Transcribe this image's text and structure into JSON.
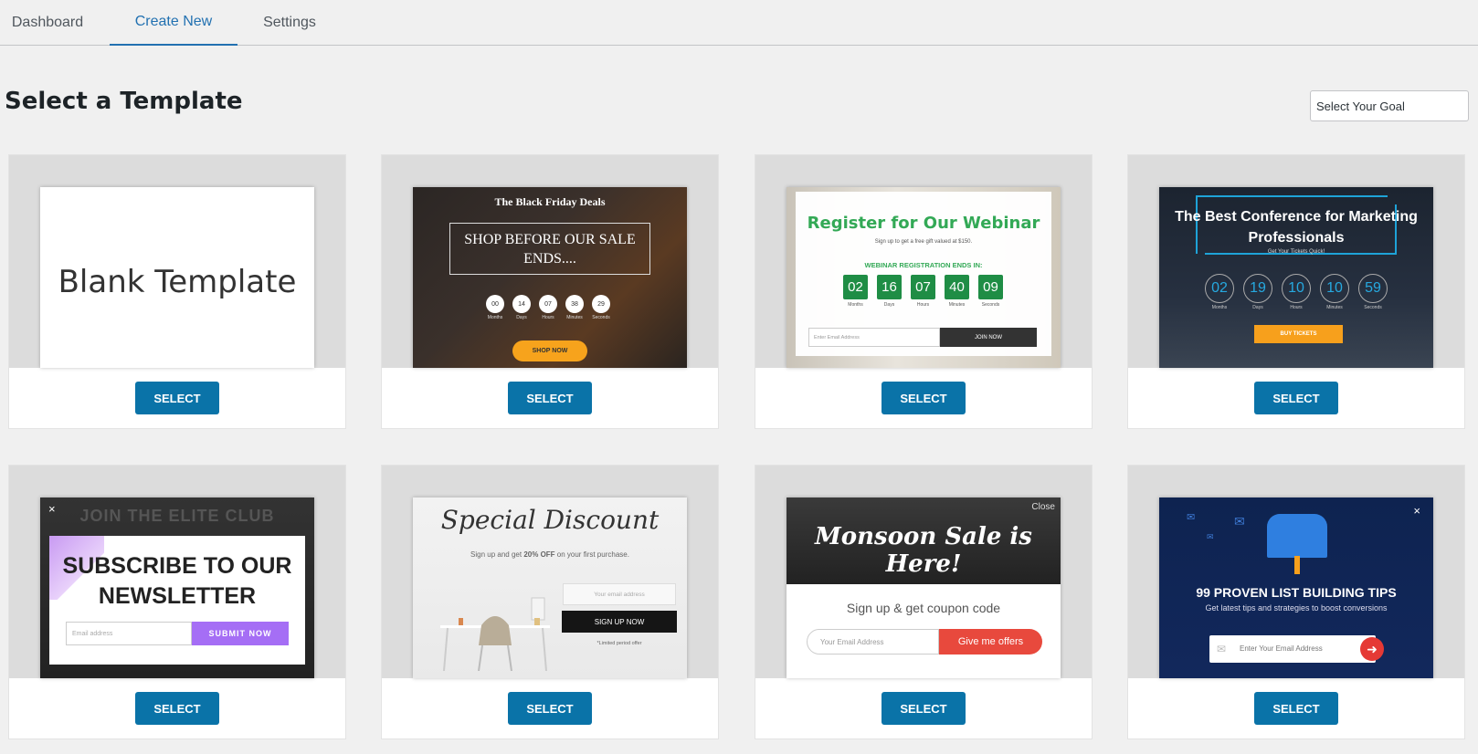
{
  "tabs": [
    {
      "label": "Dashboard"
    },
    {
      "label": "Create New"
    },
    {
      "label": "Settings"
    }
  ],
  "header": {
    "title": "Select a Template",
    "goal_select": "Select Your Goal"
  },
  "select_label": "SELECT",
  "templates": {
    "blank": {
      "title": "Blank Template"
    },
    "black_friday": {
      "title": "The Black Friday Deals",
      "headline": "SHOP BEFORE OUR SALE ENDS....",
      "timer": [
        {
          "value": "00",
          "label": "Months"
        },
        {
          "value": "14",
          "label": "Days"
        },
        {
          "value": "07",
          "label": "Hours"
        },
        {
          "value": "38",
          "label": "Minutes"
        },
        {
          "value": "29",
          "label": "Seconds"
        }
      ],
      "cta": "SHOP NOW"
    },
    "webinar": {
      "title": "Register for Our Webinar",
      "subtitle": "Sign up to get a free gift valued at $150.",
      "ends": "WEBINAR REGISTRATION ENDS IN:",
      "timer": [
        {
          "value": "02",
          "label": "Months"
        },
        {
          "value": "16",
          "label": "Days"
        },
        {
          "value": "07",
          "label": "Hours"
        },
        {
          "value": "40",
          "label": "Minutes"
        },
        {
          "value": "09",
          "label": "Seconds"
        }
      ],
      "email_placeholder": "Enter Email Address",
      "cta": "JOIN NOW"
    },
    "conference": {
      "title": "The Best Conference for Marketing Professionals",
      "subtitle": "Get Your Tickets Quick!",
      "timer": [
        {
          "value": "02",
          "label": "Months"
        },
        {
          "value": "19",
          "label": "Days"
        },
        {
          "value": "10",
          "label": "Hours"
        },
        {
          "value": "10",
          "label": "Minutes"
        },
        {
          "value": "59",
          "label": "Seconds"
        }
      ],
      "cta": "BUY TICKETS"
    },
    "newsletter": {
      "background_text": "JOIN THE ELITE CLUB",
      "close": "×",
      "title": "SUBSCRIBE TO OUR NEWSLETTER",
      "email_placeholder": "Email address",
      "cta": "SUBMIT NOW"
    },
    "discount": {
      "title": "Special Discount",
      "subtitle_pre": "Sign up and get ",
      "subtitle_bold": "20% OFF",
      "subtitle_post": " on your first purchase.",
      "email_placeholder": "Your email address",
      "cta": "SIGN UP NOW",
      "note": "*Limited period offer"
    },
    "monsoon": {
      "close": "Close",
      "title": "Monsoon Sale is Here!",
      "subtitle": "Sign up & get coupon code",
      "email_placeholder": "Your Email Address",
      "cta": "Give me offers"
    },
    "list_building": {
      "close": "×",
      "title": "99 PROVEN LIST BUILDING TIPS",
      "subtitle": "Get latest tips and strategies to boost conversions",
      "email_placeholder": "Enter Your Email Address",
      "cta_icon": "arrow-right-icon"
    }
  },
  "colors": {
    "accent": "#2271b1",
    "select_button": "#0a73a8",
    "background": "#f0f0f0"
  }
}
